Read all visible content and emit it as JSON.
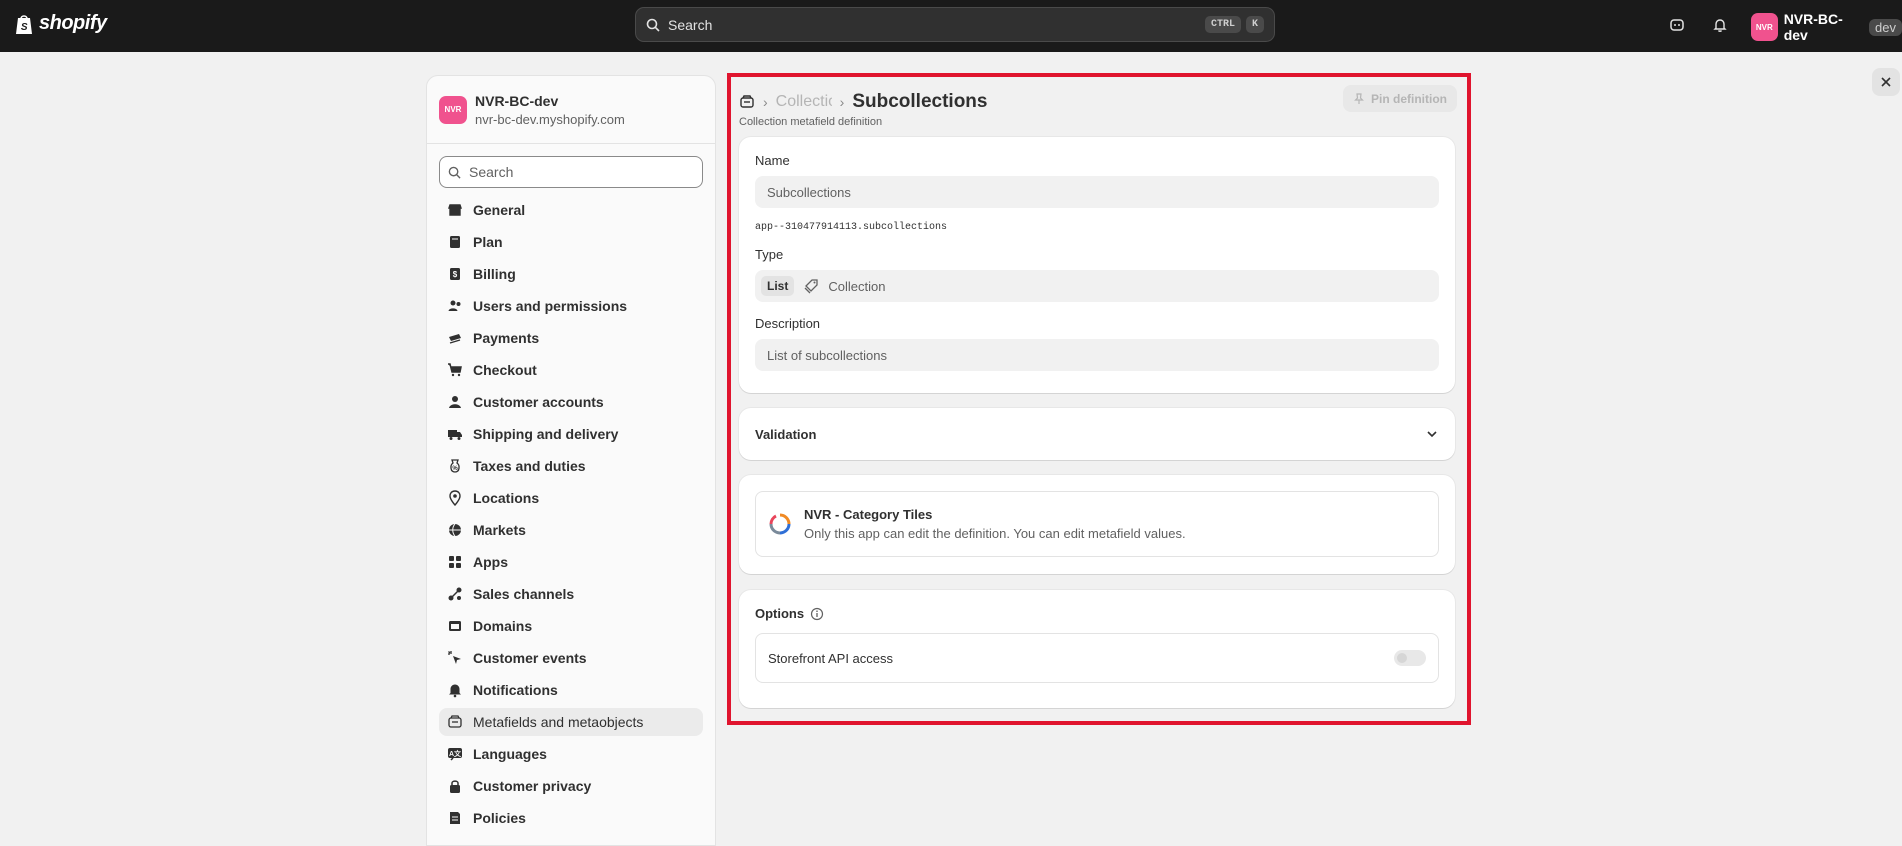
{
  "topbar": {
    "logo_text": "shopify",
    "search_placeholder": "Search",
    "kbd_ctrl": "CTRL",
    "kbd_k": "K",
    "store_avatar": "NVR",
    "store_name": "NVR-BC-dev",
    "store_tag": "dev"
  },
  "sidebar": {
    "shop_avatar": "NVR",
    "shop_name": "NVR-BC-dev",
    "shop_url": "nvr-bc-dev.myshopify.com",
    "search_placeholder": "Search",
    "items": [
      {
        "label": "General",
        "icon": "store-icon"
      },
      {
        "label": "Plan",
        "icon": "plan-icon"
      },
      {
        "label": "Billing",
        "icon": "billing-icon"
      },
      {
        "label": "Users and permissions",
        "icon": "users-icon"
      },
      {
        "label": "Payments",
        "icon": "payments-icon"
      },
      {
        "label": "Checkout",
        "icon": "cart-icon"
      },
      {
        "label": "Customer accounts",
        "icon": "person-icon"
      },
      {
        "label": "Shipping and delivery",
        "icon": "truck-icon"
      },
      {
        "label": "Taxes and duties",
        "icon": "tax-icon"
      },
      {
        "label": "Locations",
        "icon": "location-icon"
      },
      {
        "label": "Markets",
        "icon": "globe-icon"
      },
      {
        "label": "Apps",
        "icon": "apps-icon"
      },
      {
        "label": "Sales channels",
        "icon": "channels-icon"
      },
      {
        "label": "Domains",
        "icon": "domain-icon"
      },
      {
        "label": "Customer events",
        "icon": "cursor-icon"
      },
      {
        "label": "Notifications",
        "icon": "bell-icon"
      },
      {
        "label": "Metafields and metaobjects",
        "icon": "metafield-icon",
        "active": true
      },
      {
        "label": "Languages",
        "icon": "language-icon"
      },
      {
        "label": "Customer privacy",
        "icon": "lock-icon"
      },
      {
        "label": "Policies",
        "icon": "policy-icon"
      }
    ]
  },
  "main": {
    "breadcrumb_prev": "Collectio",
    "title": "Subcollections",
    "subtitle": "Collection metafield definition",
    "pin_button": "Pin definition",
    "name_label": "Name",
    "name_value": "Subcollections",
    "namespace_key": "app--310477914113.subcollections",
    "type_label": "Type",
    "type_list_chip": "List",
    "type_value": "Collection",
    "description_label": "Description",
    "description_value": "List of subcollections",
    "validation_label": "Validation",
    "app_name": "NVR - Category Tiles",
    "app_description": "Only this app can edit the definition. You can edit metafield values.",
    "options_label": "Options",
    "storefront_label": "Storefront API access",
    "storefront_enabled": false
  },
  "colors": {
    "topbar": "#1a1a1a",
    "highlight": "#e0142e",
    "avatar": "#f0528e"
  }
}
